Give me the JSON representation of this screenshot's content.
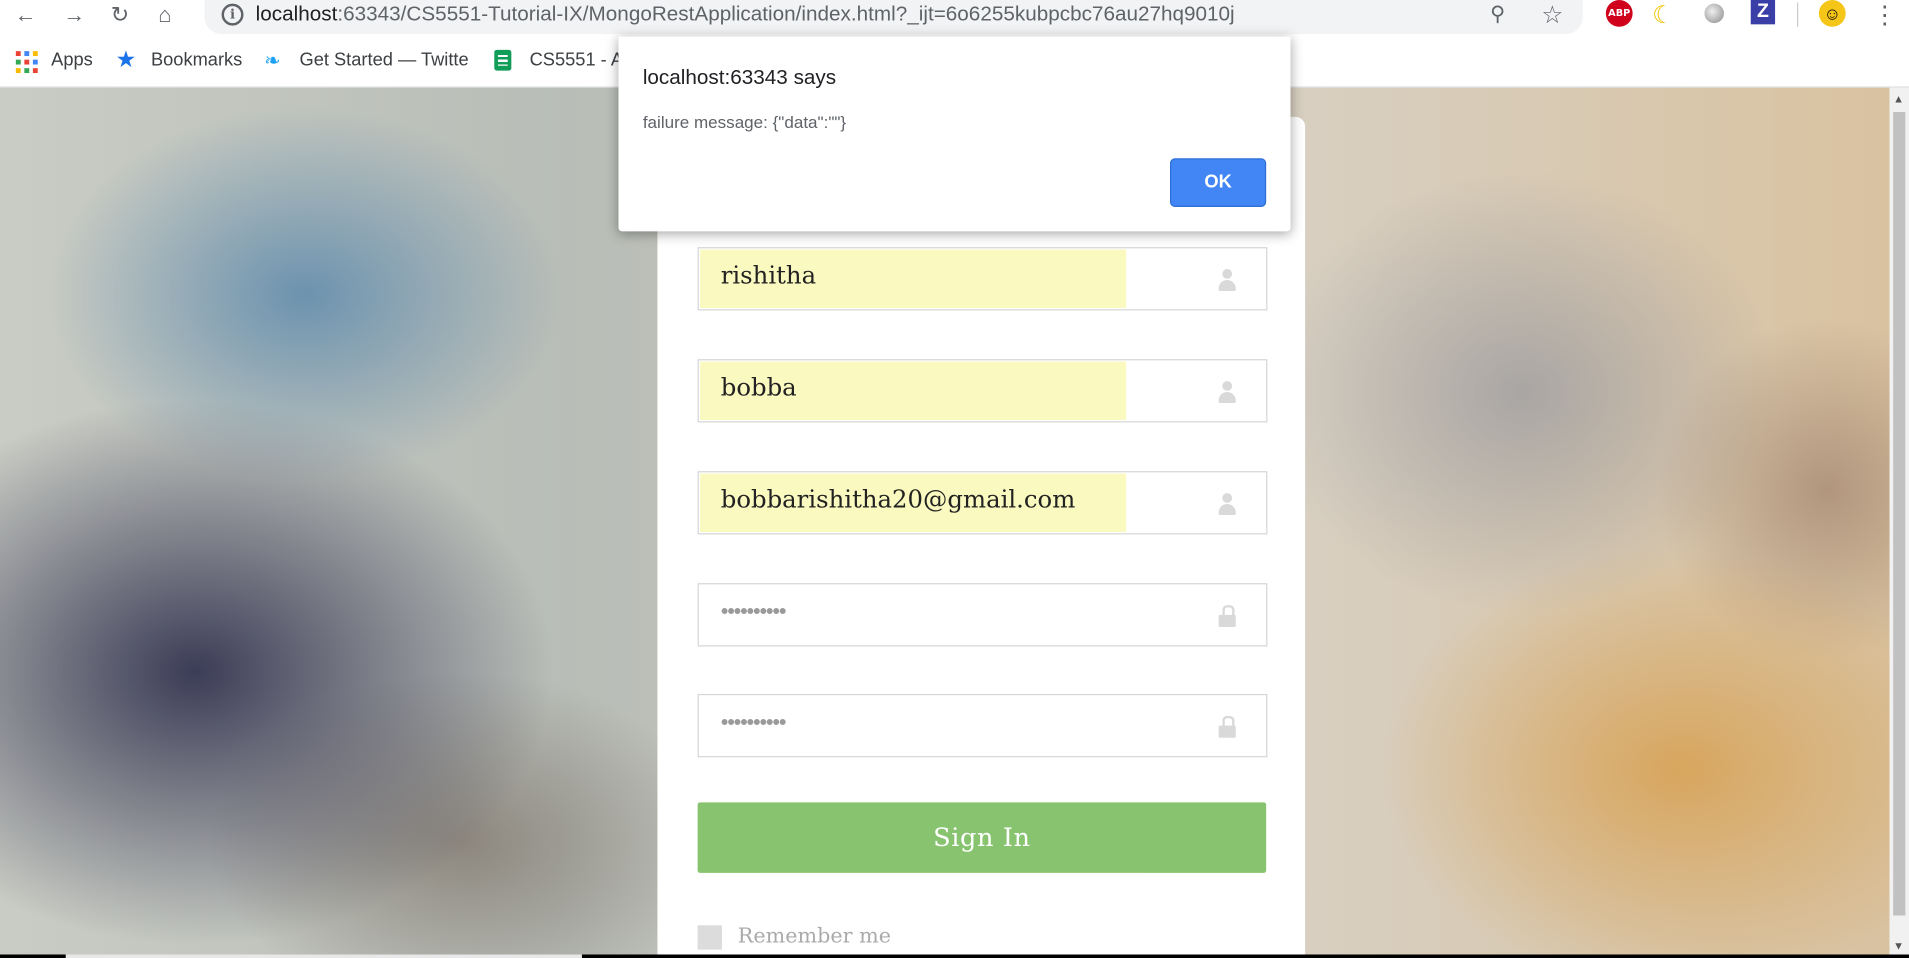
{
  "browser": {
    "url_host": "localhost",
    "url_rest": ":63343/CS5551-Tutorial-IX/MongoRestApplication/index.html?_ijt=6o6255kubpcbc76au27hq9010j",
    "extensions": [
      "ABP"
    ],
    "bookmarks": [
      {
        "label": "Apps",
        "icon": "apps-grid-icon"
      },
      {
        "label": "Bookmarks",
        "icon": "star-icon"
      },
      {
        "label": "Get Started — Twitte",
        "icon": "twitter-icon"
      },
      {
        "label": "CS5551 - A",
        "icon": "sheets-icon"
      }
    ]
  },
  "form": {
    "first_name": "rishitha",
    "last_name": "bobba",
    "email": "bobbarishitha20@gmail.com",
    "password_mask": "••••••••••",
    "confirm_mask": "••••••••••",
    "submit_label": "Sign In",
    "remember_label": "Remember me"
  },
  "alert": {
    "title": "localhost:63343 says",
    "message": "failure message: {\"data\":\"\"}",
    "ok_label": "OK"
  },
  "colors": {
    "sign_in_button": "#88c470",
    "ok_button": "#4285f4",
    "autofill_background": "#fafac0"
  }
}
